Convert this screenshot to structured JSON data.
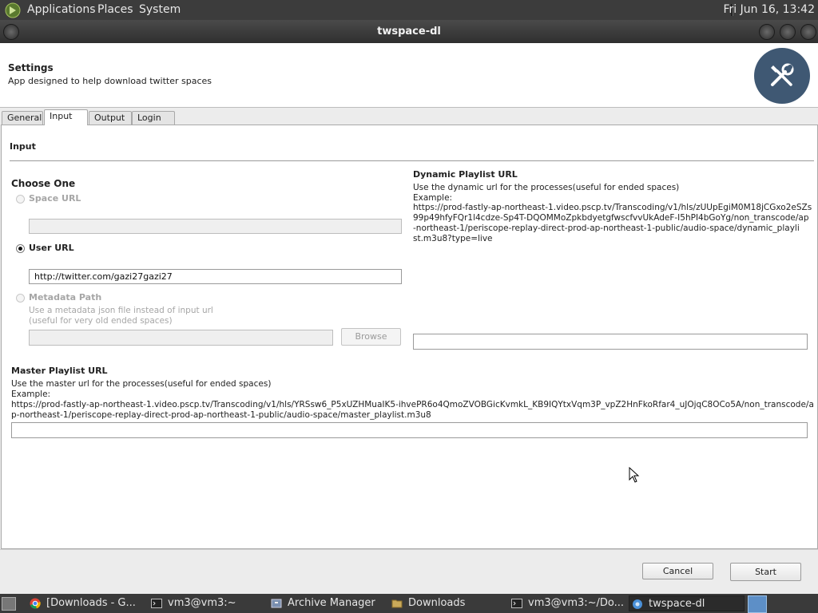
{
  "panel": {
    "menus": [
      "Applications",
      "Places",
      "System"
    ],
    "clock": "Fri Jun 16, 13:42"
  },
  "window": {
    "title": "twspace-dl"
  },
  "header": {
    "title": "Settings",
    "subtitle": "App designed to help download twitter spaces",
    "icon": "tools-icon",
    "icon_color": "#3f5873"
  },
  "tabs": [
    "General",
    "Input",
    "Output",
    "Login"
  ],
  "active_tab": "Input",
  "input": {
    "section_title": "Input",
    "choose_one": "Choose One",
    "space_url": {
      "label": "Space URL",
      "value": ""
    },
    "user_url": {
      "label": "User URL",
      "value": "http://twitter.com/gazi27gazi27",
      "selected": true
    },
    "metadata": {
      "label": "Metadata Path",
      "desc1": "Use a metadata json file instead of input url",
      "desc2": "(useful for very old ended spaces)",
      "value": "",
      "browse": "Browse"
    },
    "dynamic": {
      "title": "Dynamic Playlist URL",
      "desc": "Use the dynamic url for the processes(useful for ended spaces)",
      "example_label": "Example:",
      "example_lines": [
        "https://prod-fastly-ap-northeast-1.video.pscp.tv/Transcoding/v1/hls/zUUpEgiM0M18jCGxo2eSZs",
        "99p49hfyFQr1l4cdze-Sp4T-DQOMMoZpkbdyetgfwscfvvUkAdeF-I5hPI4bGoYg/non_transcode/ap",
        "-northeast-1/periscope-replay-direct-prod-ap-northeast-1-public/audio-space/dynamic_playli",
        "st.m3u8?type=live"
      ],
      "value": ""
    },
    "master": {
      "title": "Master Playlist URL",
      "desc": "Use the master url for the processes(useful for ended spaces)",
      "example_label": "Example:",
      "example_lines": [
        "https://prod-fastly-ap-northeast-1.video.pscp.tv/Transcoding/v1/hls/YRSsw6_P5xUZHMuaIK5-ihvePR6o4QmoZVOBGicKvmkL_KB9IQYtxVqm3P_vpZ2HnFkoRfar4_uJOjqC8OCo5A/non_transcode/a",
        "p-northeast-1/periscope-replay-direct-prod-ap-northeast-1-public/audio-space/master_playlist.m3u8"
      ],
      "value": ""
    }
  },
  "buttons": {
    "cancel": "Cancel",
    "start": "Start"
  },
  "taskbar": [
    {
      "label": "[Downloads - G...",
      "icon": "chrome-icon"
    },
    {
      "label": "vm3@vm3:~",
      "icon": "terminal-icon"
    },
    {
      "label": "Archive Manager",
      "icon": "archive-icon"
    },
    {
      "label": "Downloads",
      "icon": "folder-icon"
    },
    {
      "label": "vm3@vm3:~/Do...",
      "icon": "terminal-icon"
    },
    {
      "label": "twspace-dl",
      "icon": "app-icon",
      "active": true
    }
  ]
}
